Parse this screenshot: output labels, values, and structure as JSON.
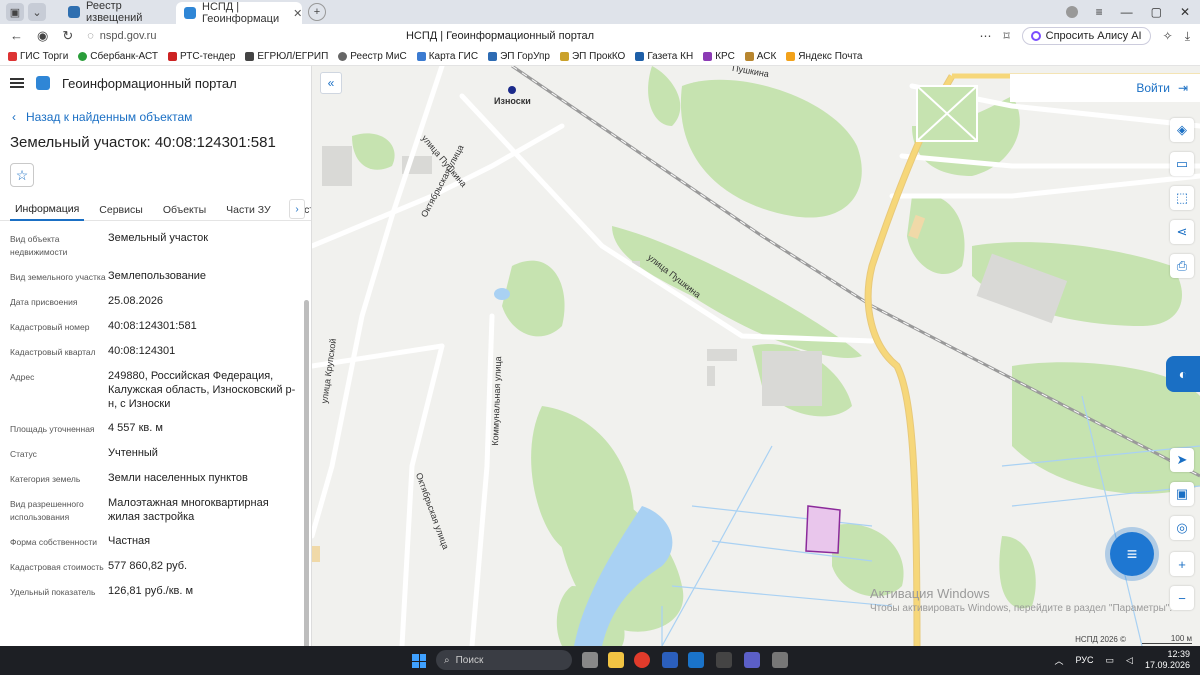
{
  "browser": {
    "tabs": [
      {
        "label": "Реестр извещений",
        "active": false
      },
      {
        "label": "НСПД | Геоинформаци",
        "active": true
      }
    ],
    "url": "nspd.gov.ru",
    "page_title": "НСПД | Геоинформационный портал",
    "alisa_label": "Спросить Алису AI",
    "bookmarks": [
      "ГИС Торги",
      "Сбербанк-АСТ",
      "РТС-тендер",
      "ЕГРЮЛ/ЕГРИП",
      "Реестр МиС",
      "Карта ГИС",
      "ЭП ГорУпр",
      "ЭП ПрокКО",
      "Газета КН",
      "КРС",
      "АСК",
      "Яндекс Почта"
    ]
  },
  "portal": {
    "title": "Геоинформационный портал",
    "back_label": "Назад к найденным объектам",
    "object_title": "Земельный участок: 40:08:124301:581",
    "tabs": [
      "Информация",
      "Сервисы",
      "Объекты",
      "Части ЗУ",
      "Состав"
    ],
    "properties": [
      {
        "label": "Вид объекта недвижимости",
        "value": "Земельный участок"
      },
      {
        "label": "Вид земельного участка",
        "value": "Землепользование"
      },
      {
        "label": "Дата присвоения",
        "value": "25.08.2026"
      },
      {
        "label": "Кадастровый номер",
        "value": "40:08:124301:581"
      },
      {
        "label": "Кадастровый квартал",
        "value": "40:08:124301"
      },
      {
        "label": "Адрес",
        "value": "249880, Российская Федерация, Калужская область, Износковский р-н, с Износки"
      },
      {
        "label": "Площадь уточненная",
        "value": "4 557 кв. м"
      },
      {
        "label": "Статус",
        "value": "Учтенный"
      },
      {
        "label": "Категория земель",
        "value": "Земли населенных пунктов"
      },
      {
        "label": "Вид разрешенного использования",
        "value": "Малоэтажная многоквартирная жилая застройка"
      },
      {
        "label": "Форма собственности",
        "value": "Частная"
      },
      {
        "label": "Кадастровая стоимость",
        "value": "577 860,82 руб."
      },
      {
        "label": "Удельный показатель",
        "value": "126,81 руб./кв. м"
      }
    ]
  },
  "map": {
    "login_label": "Войти",
    "labels": {
      "iznoski": "Износки",
      "pushkina_1": "улица Пушкина",
      "pushkina_2": "улица Пушкина",
      "pushkina_3": "Пушкина",
      "oktyabrskaya_1": "Октябрьская улица",
      "oktyabrskaya_2": "Октябрьская улица",
      "kommunalnaya": "Коммунальная улица",
      "krupskoy": "улица Крупской"
    },
    "watermark_title": "Активация Windows",
    "watermark_sub": "Чтобы активировать Windows, перейдите в раздел \"Параметры\".",
    "attribution": "НСПД 2026 ©",
    "scale": "100 м",
    "colors": {
      "parcel_fill": "#e9c6ec",
      "parcel_stroke": "#8b2a9a",
      "forest": "#c6e3b0",
      "water": "#a9d1f3",
      "road_major": "#f6d77a"
    }
  },
  "taskbar": {
    "search_placeholder": "Поиск",
    "lang": "РУС",
    "time": "12:39",
    "date": "17.09.2026"
  }
}
